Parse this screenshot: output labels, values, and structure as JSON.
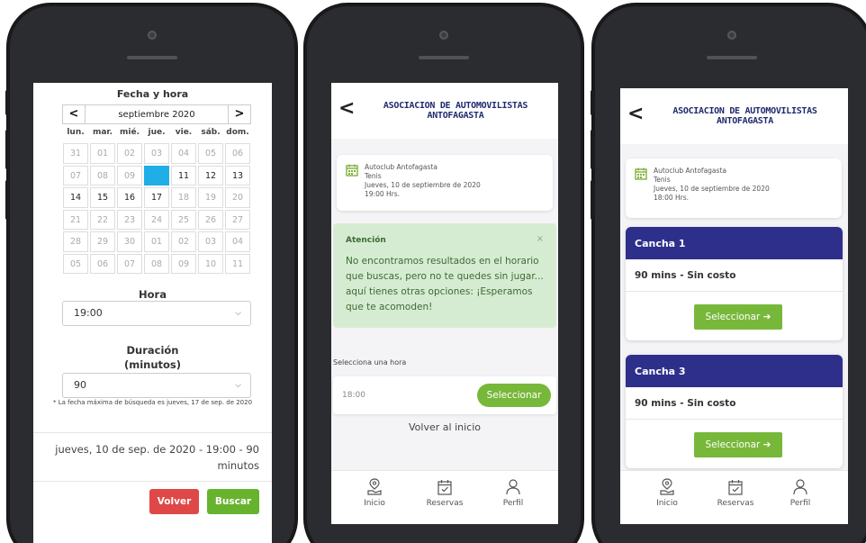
{
  "screen1": {
    "title": "Fecha y hora",
    "prev": "<",
    "next": ">",
    "month": "septiembre 2020",
    "weekdays": [
      "lun.",
      "mar.",
      "mié.",
      "jue.",
      "vie.",
      "sáb.",
      "dom."
    ],
    "weeks": [
      [
        {
          "d": "31",
          "a": false
        },
        {
          "d": "01",
          "a": false
        },
        {
          "d": "02",
          "a": false
        },
        {
          "d": "03",
          "a": false
        },
        {
          "d": "04",
          "a": false
        },
        {
          "d": "05",
          "a": false
        },
        {
          "d": "06",
          "a": false
        }
      ],
      [
        {
          "d": "07",
          "a": false
        },
        {
          "d": "08",
          "a": false
        },
        {
          "d": "09",
          "a": false
        },
        {
          "d": "10",
          "a": true,
          "s": true
        },
        {
          "d": "11",
          "a": true
        },
        {
          "d": "12",
          "a": true
        },
        {
          "d": "13",
          "a": true
        }
      ],
      [
        {
          "d": "14",
          "a": true
        },
        {
          "d": "15",
          "a": true
        },
        {
          "d": "16",
          "a": true
        },
        {
          "d": "17",
          "a": true
        },
        {
          "d": "18",
          "a": false
        },
        {
          "d": "19",
          "a": false
        },
        {
          "d": "20",
          "a": false
        }
      ],
      [
        {
          "d": "21",
          "a": false
        },
        {
          "d": "22",
          "a": false
        },
        {
          "d": "23",
          "a": false
        },
        {
          "d": "24",
          "a": false
        },
        {
          "d": "25",
          "a": false
        },
        {
          "d": "26",
          "a": false
        },
        {
          "d": "27",
          "a": false
        }
      ],
      [
        {
          "d": "28",
          "a": false
        },
        {
          "d": "29",
          "a": false
        },
        {
          "d": "30",
          "a": false
        },
        {
          "d": "01",
          "a": false
        },
        {
          "d": "02",
          "a": false
        },
        {
          "d": "03",
          "a": false
        },
        {
          "d": "04",
          "a": false
        }
      ],
      [
        {
          "d": "05",
          "a": false
        },
        {
          "d": "06",
          "a": false
        },
        {
          "d": "07",
          "a": false
        },
        {
          "d": "08",
          "a": false
        },
        {
          "d": "09",
          "a": false
        },
        {
          "d": "10",
          "a": false
        },
        {
          "d": "11",
          "a": false
        }
      ]
    ],
    "hora_label": "Hora",
    "hora_value": "19:00",
    "duracion_label_1": "Duración",
    "duracion_label_2": "(minutos)",
    "duracion_value": "90",
    "note": "* La fecha máxima de búsqueda es jueves, 17 de sep. de 2020",
    "summary_line1": "jueves, 10 de sep. de 2020 - 19:00 - 90",
    "summary_line2": "minutos",
    "volver": "Volver",
    "buscar": "Buscar"
  },
  "screen2": {
    "header_title_1": "ASOCIACION DE AUTOMOVILISTAS",
    "header_title_2": "ANTOFAGASTA",
    "back": "<",
    "info": {
      "club": "Autoclub Antofagasta",
      "sport": "Tenis",
      "date": "Jueves, 10 de septiembre de 2020",
      "time": "19:00 Hrs."
    },
    "alert_title": "Atención",
    "alert_close": "×",
    "alert_body": "No encontramos resultados en el horario que buscas, pero no te quedes sin jugar... aquí tienes otras opciones: ¡Esperamos que te acomoden!",
    "select_hour_label": "Selecciona una hora",
    "time_option": "18:00",
    "select_button": "Seleccionar",
    "back_home": "Volver al inicio"
  },
  "screen3": {
    "header_title_1": "ASOCIACION DE AUTOMOVILISTAS",
    "header_title_2": "ANTOFAGASTA",
    "back": "<",
    "info": {
      "club": "Autoclub Antofagasta",
      "sport": "Tenis",
      "date": "Jueves, 10 de septiembre de 2020",
      "time": "18:00 Hrs."
    },
    "courts": [
      {
        "name": "Cancha 1",
        "desc": "90 mins - Sin costo",
        "button": "Seleccionar ➔"
      },
      {
        "name": "Cancha 3",
        "desc": "90 mins - Sin costo",
        "button": "Seleccionar ➔"
      }
    ]
  },
  "tabs": [
    {
      "label": "Inicio",
      "icon": "location-hand-icon"
    },
    {
      "label": "Reservas",
      "icon": "calendar-check-icon"
    },
    {
      "label": "Perfil",
      "icon": "user-icon"
    }
  ],
  "colors": {
    "accent_blue": "#1faee6",
    "navy": "#2e2f8a",
    "green": "#77b83a",
    "red": "#e04848",
    "alert_green": "#d6ecd2"
  }
}
